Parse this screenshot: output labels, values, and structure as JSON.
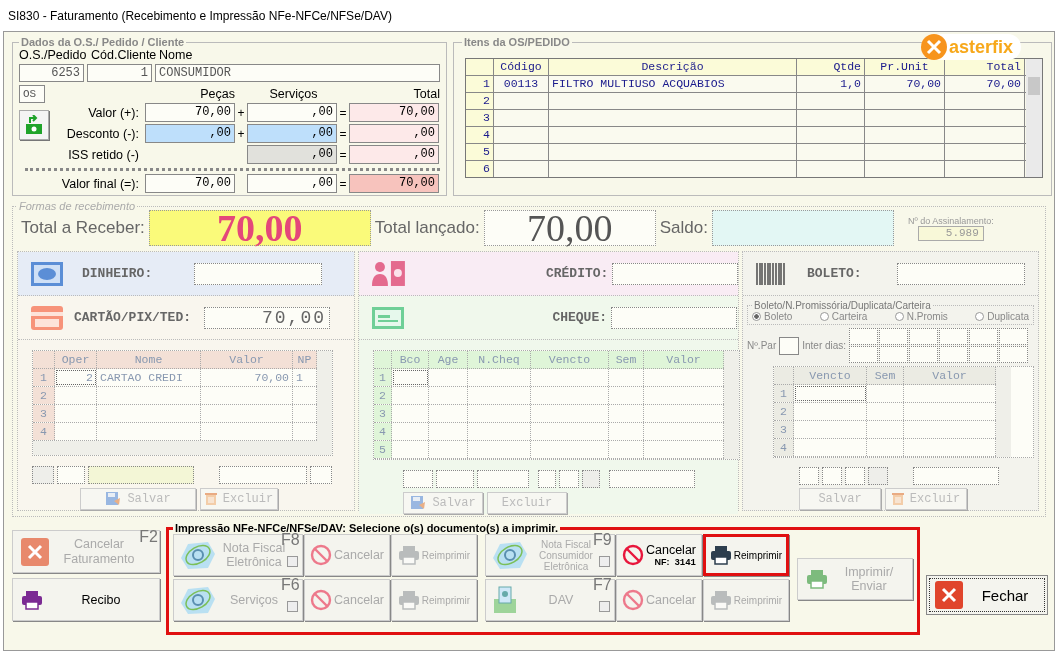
{
  "window": {
    "title": "SI830 - Faturamento (Recebimento e Impressão NFe-NFCe/NFSe/DAV)"
  },
  "order": {
    "title": "Dados da O.S./ Pedido / Cliente",
    "headers": [
      "O.S./Pedido",
      "Cód.Cliente",
      "Nome"
    ],
    "fields": [
      "6253",
      "1",
      "CONSUMIDOR"
    ],
    "type": "OS",
    "columns": [
      "Peças",
      "Serviços",
      "Total"
    ],
    "rows": [
      {
        "kind": "value",
        "label": "Valor (+):",
        "parts": "70,00",
        "plus": "+",
        "services": ",00",
        "equals": "=",
        "total": "70,00"
      },
      {
        "kind": "discount",
        "label": "Desconto (-):",
        "parts": ",00",
        "plus": "+",
        "services": ",00",
        "equals": "=",
        "total": ",00"
      },
      {
        "kind": "iss",
        "label": "ISS retido (-)",
        "services": ",00",
        "equals": "=",
        "total": ",00"
      },
      {
        "kind": "final",
        "label": "Valor final (=):",
        "parts": "70,00",
        "services": ",00",
        "equals": "=",
        "total": "70,00"
      }
    ]
  },
  "items": {
    "title": "Itens da OS/PEDIDO",
    "logo": "asterfix",
    "columns": [
      "Código",
      "Descrição",
      "Qtde",
      "Pr.Unit",
      "Total"
    ],
    "rows": [
      {
        "number": "1",
        "cells": [
          "00113",
          "FILTRO MULTIUSO ACQUABIOS",
          "1,0",
          "70,00",
          "70,00"
        ]
      },
      {
        "number": "2"
      },
      {
        "number": "3"
      },
      {
        "number": "4"
      },
      {
        "number": "5"
      },
      {
        "number": "6"
      }
    ]
  },
  "payment": {
    "title": "Formas de recebimento",
    "total_label": "Total a Receber:",
    "total": "70,00",
    "launched_label": "Total lançado:",
    "launched": "70,00",
    "balance_label": "Saldo:",
    "signal_label": "Nº do Assinalamento:",
    "signal": "5.989",
    "cash": {
      "label": "DINHEIRO:"
    },
    "card": {
      "label": "CARTÃO/PIX/TED:",
      "value": "70,00",
      "columns": [
        "Oper",
        "Nome",
        "Valor",
        "NP"
      ],
      "rows": [
        {
          "number": "1",
          "cells": [
            "2",
            "CARTAO CREDI",
            "70,00",
            "1"
          ]
        },
        {
          "number": "2"
        },
        {
          "number": "3"
        },
        {
          "number": "4"
        }
      ],
      "buttons": [
        {
          "kind": "save",
          "label": "Salvar",
          "disabled": true
        },
        {
          "kind": "delete",
          "label": "Excluir",
          "disabled": true
        }
      ]
    },
    "credit": {
      "label": "CRÉDITO:"
    },
    "check": {
      "label": "CHEQUE:",
      "columns": [
        "Bco",
        "Age",
        "N.Cheq",
        "Vencto",
        "Sem",
        "Valor"
      ],
      "rows": [
        {
          "number": "1"
        },
        {
          "number": "2"
        },
        {
          "number": "3"
        },
        {
          "number": "4"
        },
        {
          "number": "5"
        }
      ],
      "buttons": [
        {
          "kind": "save",
          "label": "Salvar",
          "disabled": true
        },
        {
          "kind": "plain",
          "label": "Excluir",
          "disabled": true
        }
      ]
    },
    "boleto": {
      "label": "BOLETO:",
      "group": "Boleto/N.Promissória/Duplicata/Carteira",
      "options": [
        {
          "label": "Boleto",
          "selected": true
        },
        {
          "label": "Carteira",
          "selected": false
        },
        {
          "label": "N.Promis",
          "selected": false
        },
        {
          "label": "Duplicata",
          "selected": false
        }
      ],
      "installments_label": "Nº.Par",
      "interval_label": "Inter dias:",
      "columns": [
        "Vencto",
        "Sem",
        "Valor"
      ],
      "rows": [
        {
          "number": "1"
        },
        {
          "number": "2"
        },
        {
          "number": "3"
        },
        {
          "number": "4"
        }
      ],
      "buttons": [
        {
          "kind": "plain",
          "label": "Salvar",
          "disabled": true
        },
        {
          "kind": "delete",
          "label": "Excluir",
          "disabled": true
        }
      ]
    }
  },
  "bottom": {
    "cancel_billing": {
      "label": "Cancelar Faturamento",
      "key": "F2",
      "disabled": true
    },
    "receipt": {
      "label": "Recibo"
    },
    "print": {
      "title": "Impressão NFe-NFCe/NFSe/DAV: Selecione o(s) documento(s) a imprimir.",
      "documents": [
        {
          "kind": "nfe",
          "label": "Nota Fiscal Eletrônica",
          "key": "F8",
          "checked": false,
          "disabled": true,
          "cancel": {
            "label": "Cancelar",
            "disabled": true
          },
          "reprint": {
            "label": "Reimprimir",
            "disabled": true,
            "highlighted": false
          }
        },
        {
          "kind": "nfce",
          "label": "Nota Fiscal Consumidor Eletrônica",
          "key": "F9",
          "checked": false,
          "disabled": true,
          "cancel": {
            "label": "Cancelar",
            "disabled": false,
            "note": "NF:",
            "number": "3141"
          },
          "reprint": {
            "label": "Reimprimir",
            "disabled": false,
            "highlighted": true
          }
        },
        {
          "kind": "nfse",
          "label": "Serviços",
          "key": "F6",
          "checked": false,
          "disabled": true,
          "cancel": {
            "label": "Cancelar",
            "disabled": true
          },
          "reprint": {
            "label": "Reimprimir",
            "disabled": true,
            "highlighted": false
          }
        },
        {
          "kind": "dav",
          "label": "DAV",
          "key": "F7",
          "checked": false,
          "disabled": true,
          "cancel": {
            "label": "Cancelar",
            "disabled": true
          },
          "reprint": {
            "label": "Reimprimir",
            "disabled": true,
            "highlighted": false
          }
        }
      ],
      "send": {
        "label": "Imprimir/ Enviar",
        "disabled": true
      }
    },
    "close": {
      "label": "Fechar"
    }
  }
}
